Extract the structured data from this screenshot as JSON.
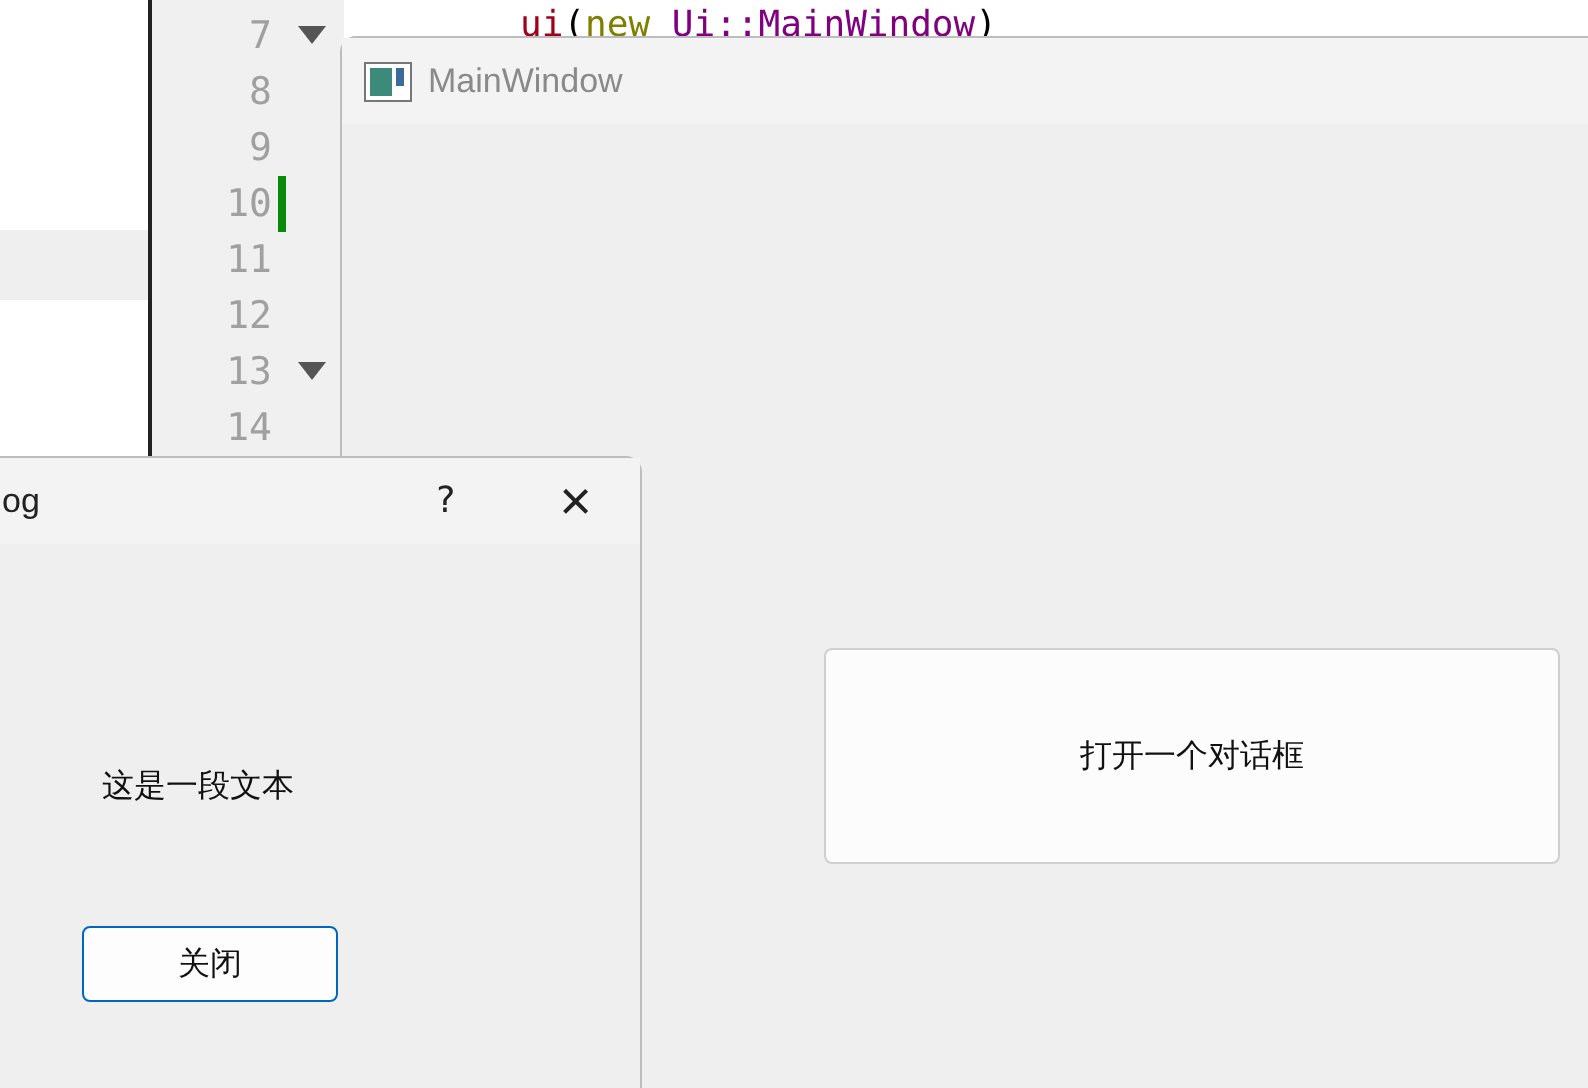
{
  "editor": {
    "line_numbers": [
      {
        "number": "7",
        "foldable": true,
        "changed": false
      },
      {
        "number": "8",
        "foldable": false,
        "changed": false
      },
      {
        "number": "9",
        "foldable": false,
        "changed": false
      },
      {
        "number": "10",
        "foldable": false,
        "changed": true
      },
      {
        "number": "11",
        "foldable": false,
        "changed": false
      },
      {
        "number": "12",
        "foldable": false,
        "changed": false
      },
      {
        "number": "13",
        "foldable": true,
        "changed": false
      },
      {
        "number": "14",
        "foldable": false,
        "changed": false
      }
    ],
    "code_line": {
      "call": "ui",
      "open": "(",
      "keyword": "new",
      "type": "Ui::MainWindow",
      "close": ")"
    }
  },
  "main_window": {
    "title": "MainWindow",
    "button": "打开一个对话框"
  },
  "dialog": {
    "title": "og",
    "help": "?",
    "close": "×",
    "text": "这是一段文本",
    "button": "关闭"
  }
}
